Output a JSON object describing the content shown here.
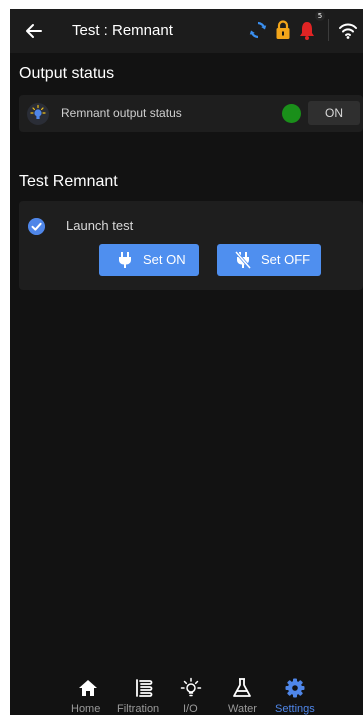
{
  "header": {
    "title": "Test : Remnant",
    "notification_count": "5"
  },
  "output_status": {
    "section_title": "Output status",
    "label": "Remnant output status",
    "value": "ON",
    "indicator_color": "#1a8f1a"
  },
  "test_remnant": {
    "section_title": "Test Remnant",
    "launch_label": "Launch test",
    "set_on_label": "Set ON",
    "set_off_label": "Set OFF"
  },
  "tabs": [
    {
      "label": "Home",
      "icon": "home-icon"
    },
    {
      "label": "Filtration",
      "icon": "filtration-icon"
    },
    {
      "label": "I/O",
      "icon": "bulb-icon"
    },
    {
      "label": "Water",
      "icon": "flask-icon"
    },
    {
      "label": "Settings",
      "icon": "gear-icon",
      "active": true
    }
  ],
  "colors": {
    "accent": "#4f86e8",
    "sync": "#3a8ff0",
    "lock": "#f2a51a",
    "bell": "#e02424",
    "background": "#121212"
  }
}
